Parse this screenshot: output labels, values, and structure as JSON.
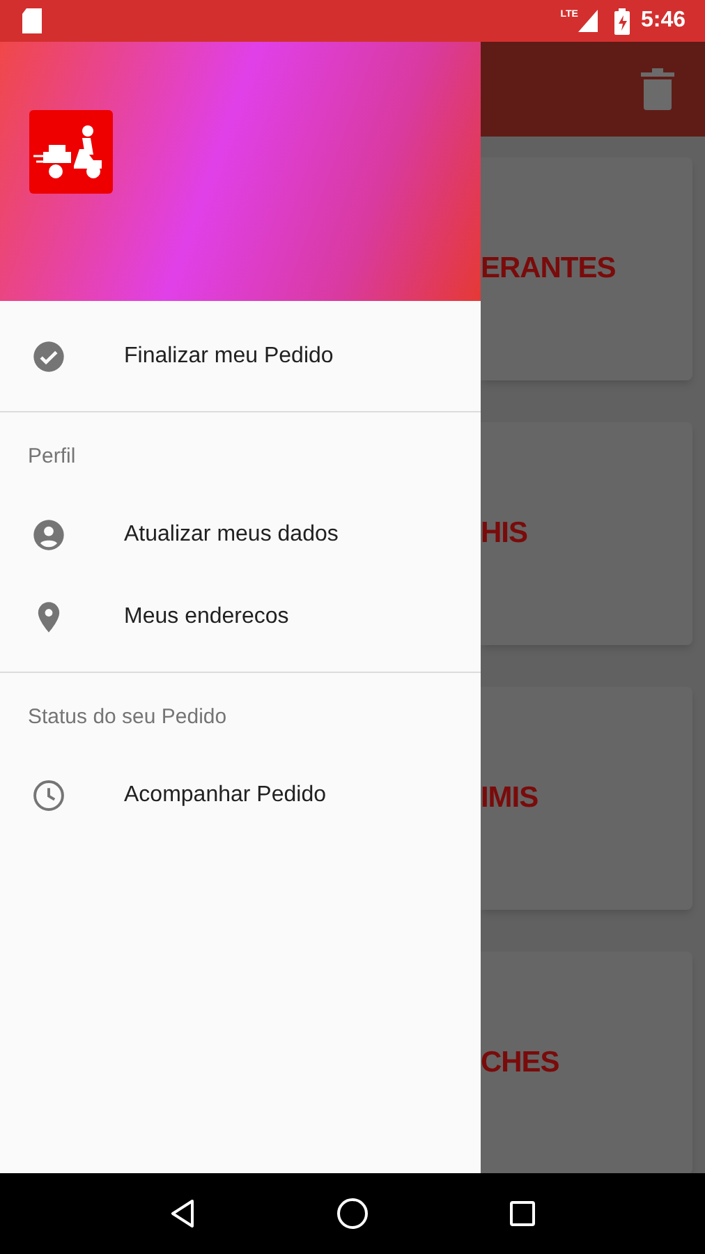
{
  "status_bar": {
    "network": "LTE",
    "time": "5:46"
  },
  "app_bar": {
    "actions": [
      {
        "kind": "delete"
      }
    ]
  },
  "categories": [
    {
      "label": "ERANTES"
    },
    {
      "label": "HIS"
    },
    {
      "label": "IMIS"
    },
    {
      "label": "CHES"
    }
  ],
  "drawer": {
    "groups": [
      {
        "items": [
          {
            "kind": "check",
            "label": "Finalizar meu Pedido"
          }
        ]
      },
      {
        "title": "Perfil",
        "items": [
          {
            "kind": "account",
            "label": "Atualizar meus dados"
          },
          {
            "kind": "pin",
            "label": "Meus enderecos"
          }
        ]
      },
      {
        "title": "Status do seu Pedido",
        "items": [
          {
            "kind": "clock",
            "label": "Acompanhar Pedido"
          }
        ]
      }
    ]
  },
  "nav_bar": {
    "buttons": [
      {
        "kind": "back"
      },
      {
        "kind": "home"
      },
      {
        "kind": "recents"
      }
    ]
  }
}
